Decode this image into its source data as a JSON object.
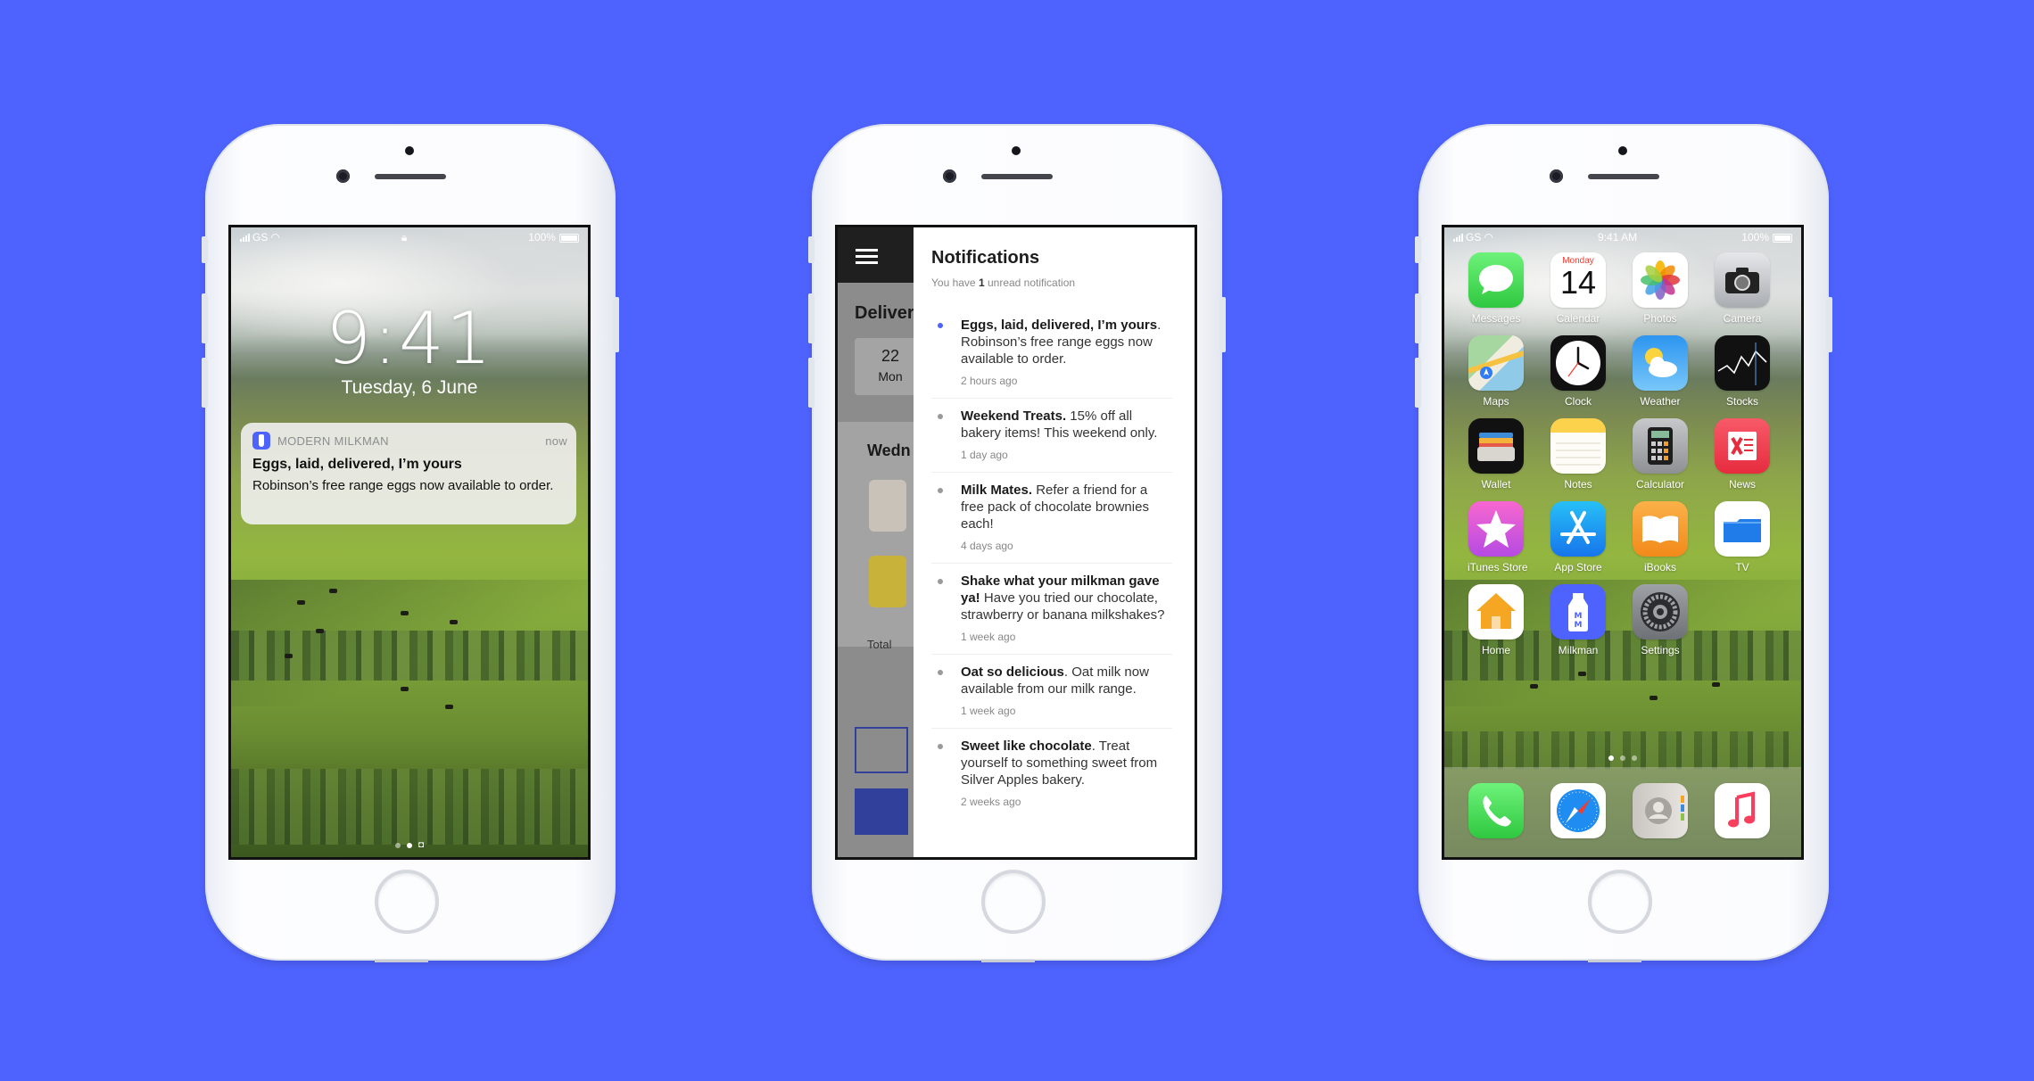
{
  "colors": {
    "background": "#4e63fd",
    "accent": "#4e63fd"
  },
  "phone1": {
    "status": {
      "carrier": "GS",
      "battery": "100%",
      "lock_icon": "lock-icon"
    },
    "time": "9:41",
    "date": "Tuesday, 6 June",
    "notification": {
      "app": "MODERN MILKMAN",
      "when": "now",
      "title": "Eggs, laid, delivered, I’m yours",
      "body": "Robinson’s free range eggs now available to order."
    }
  },
  "phone2": {
    "app": {
      "heading": "Deliver",
      "date_day": "22",
      "date_weekday": "Mon",
      "section": "Wedn",
      "total_label": "Total"
    },
    "drawer": {
      "title": "Notifications",
      "summary_pre": "You have ",
      "summary_count": "1",
      "summary_post": " unread notification",
      "items": [
        {
          "title": "Eggs, laid, delivered, I’m yours",
          "text": ". Robinson’s free range eggs now available to order.",
          "time": "2 hours ago",
          "unread": true
        },
        {
          "title": "Weekend Treats.",
          "text": " 15% off all bakery items! This weekend only.",
          "time": "1 day ago",
          "unread": false
        },
        {
          "title": "Milk Mates.",
          "text": " Refer a friend for a free pack of chocolate brownies each!",
          "time": "4 days ago",
          "unread": false
        },
        {
          "title": "Shake what your milkman gave ya!",
          "text": " Have you tried our chocolate, strawberry or banana milkshakes?",
          "time": "1 week ago",
          "unread": false
        },
        {
          "title": "Oat so delicious",
          "text": ". Oat milk now available from our milk range.",
          "time": "1 week ago",
          "unread": false
        },
        {
          "title": "Sweet like chocolate",
          "text": ". Treat yourself to something sweet from Silver Apples bakery.",
          "time": "2 weeks ago",
          "unread": false
        }
      ]
    }
  },
  "phone3": {
    "status": {
      "carrier": "GS",
      "time": "9:41 AM",
      "battery": "100%"
    },
    "calendar": {
      "weekday": "Monday",
      "day": "14"
    },
    "apps": [
      {
        "label": "Messages",
        "icon": "messages-icon"
      },
      {
        "label": "Calendar",
        "icon": "calendar-icon"
      },
      {
        "label": "Photos",
        "icon": "photos-icon"
      },
      {
        "label": "Camera",
        "icon": "camera-icon"
      },
      {
        "label": "Maps",
        "icon": "maps-icon"
      },
      {
        "label": "Clock",
        "icon": "clock-icon"
      },
      {
        "label": "Weather",
        "icon": "weather-icon"
      },
      {
        "label": "Stocks",
        "icon": "stocks-icon"
      },
      {
        "label": "Wallet",
        "icon": "wallet-icon"
      },
      {
        "label": "Notes",
        "icon": "notes-icon"
      },
      {
        "label": "Calculator",
        "icon": "calculator-icon"
      },
      {
        "label": "News",
        "icon": "news-icon"
      },
      {
        "label": "iTunes Store",
        "icon": "itunes-store-icon"
      },
      {
        "label": "App Store",
        "icon": "app-store-icon"
      },
      {
        "label": "iBooks",
        "icon": "ibooks-icon"
      },
      {
        "label": "TV",
        "icon": "tv-icon"
      },
      {
        "label": "Home",
        "icon": "home-icon"
      },
      {
        "label": "Milkman",
        "icon": "milkman-icon"
      },
      {
        "label": "Settings",
        "icon": "settings-icon"
      }
    ],
    "dock": [
      {
        "icon": "phone-icon"
      },
      {
        "icon": "safari-icon"
      },
      {
        "icon": "contacts-icon"
      },
      {
        "icon": "music-icon"
      }
    ]
  }
}
